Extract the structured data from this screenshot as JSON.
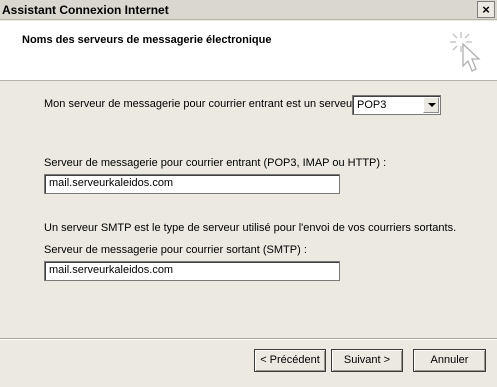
{
  "window": {
    "title": "Assistant Connexion Internet",
    "close_label": "×"
  },
  "header": {
    "title": "Noms des serveurs de messagerie électronique",
    "icon": "wizard-cursor-icon"
  },
  "incoming_type": {
    "label": "Mon serveur de messagerie pour courrier entrant est un serveur",
    "selected": "POP3"
  },
  "incoming_server": {
    "label": "Serveur de messagerie pour courrier entrant (POP3, IMAP ou HTTP) :",
    "value": "mail.serveurkaleidos.com"
  },
  "smtp_info": {
    "text": "Un serveur SMTP est le type de serveur utilisé pour l'envoi de vos courriers sortants."
  },
  "outgoing_server": {
    "label": "Serveur de messagerie pour courrier sortant (SMTP) :",
    "value": "mail.serveurkaleidos.com"
  },
  "buttons": {
    "back": "< Précédent",
    "next": "Suivant >",
    "cancel": "Annuler"
  }
}
